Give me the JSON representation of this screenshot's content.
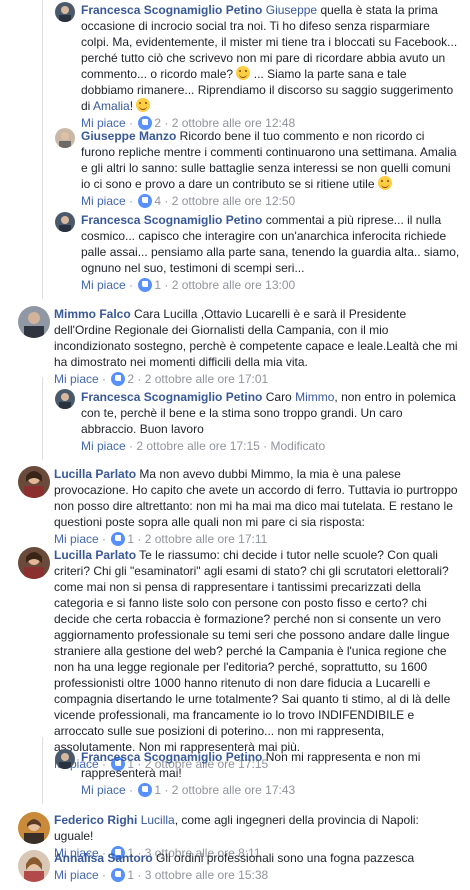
{
  "ui": {
    "like_label": "Mi piace",
    "dot": "·",
    "edited_label": "Modificato"
  },
  "comments": [
    {
      "author": "Francesca Scognamiglio Petino",
      "mention": "Giuseppe",
      "text1": " quella è stata la prima occasione di incrocio social tra noi. Ti ho difeso senza risparmiare colpi. Ma, evidentemente, il mister mi tiene tra i bloccati su Facebook... perché tutto ciò che scrivevo non mi pare di ricordare abbia avuto un commento... o ricordo male? ",
      "text2": " ... Siamo la parte sana e tale dobbiamo rimanere... Riprendiamo il discorso su saggio suggerimento di ",
      "mention2": "Amalia",
      "text3": "! ",
      "reactions": "2",
      "time": "2 ottobre alle ore 12:48"
    },
    {
      "author": "Giuseppe Manzo",
      "text": " Ricordo bene il tuo commento e non ricordo ci furono repliche mentre i commenti continuarono una settimana. Amalia e gli altri lo sanno: sulle battaglie senza interessi se non quelli comuni io ci sono e provo a dare un contributo se si ritiene utile ",
      "reactions": "4",
      "time": "2 ottobre alle ore 12:50"
    },
    {
      "author": "Francesca Scognamiglio Petino",
      "text": " commentai a più riprese... il nulla cosmico... capisco che interagire con un'anarchica inferocita richiede palle assai... pensiamo alla parte sana, tenendo la guardia alta.. siamo, ognuno nel suo, testimoni di scempi seri...",
      "reactions": "1",
      "time": "2 ottobre alle ore 13:00"
    },
    {
      "author": "Mimmo Falco",
      "text": " Cara Lucilla ,Ottavio Lucarelli è e sarà il Presidente dell'Ordine Regionale dei Giornalisti della Campania, con il mio incondizionato sostegno, perchè è competente capace e leale.Lealtà che mi ha dimostrato nei momenti difficili della mia vita.",
      "reactions": "2",
      "time": "2 ottobre alle ore 17:01"
    },
    {
      "author": "Francesca Scognamiglio Petino",
      "pre": " Caro ",
      "mention": "Mimmo",
      "text": ", non entro in polemica con te, perchè il bene e la stima sono troppo grandi. Un caro abbraccio. Buon lavoro",
      "time": "2 ottobre alle ore 17:15"
    },
    {
      "author": "Lucilla Parlato",
      "text": " Ma non avevo dubbi Mimmo, la mia è una palese provocazione. Ho capito che avete un accordo di ferro. Tuttavia io purtroppo non posso dire altrettanto: non mi ha mai ma dico mai tutelata. E restano le questioni poste sopra alle quali non mi pare ci sia risposta:",
      "reactions": "1",
      "time": "2 ottobre alle ore 17:11"
    },
    {
      "author": "Lucilla Parlato",
      "text": " Te le riassumo: chi decide i tutor nelle scuole? Con quali criteri? Chi gli \"esaminatori\" agli esami di stato? chi gli scrutatori elettorali? come mai non si pensa di rappresentare i tantissimi precarizzati della categoria e si fanno liste solo con persone con posto fisso e certo? chi decide che certa robaccia è formazione? perché non si consente un vero aggiornamento professionale su temi seri che possono andare dalle lingue straniere alla gestione del web? perché la Campania è l'unica regione che non ha una legge regionale per l'editoria? perché, soprattutto, su 1600 professionisti oltre 1000 hanno ritenuto di non dare fiducia a Lucarelli e compagnia disertando le urne totalmente? Sai quanto ti stimo, al di là delle vicende professionali, ma francamente io lo trovo INDIFENDIBILE e arroccato sulle sue posizioni di poterino... non mi rappresenta, assolutamente. Non mi rappresenterà mai più.",
      "reactions": "1",
      "time": "2 ottobre alle ore 17:15"
    },
    {
      "author": "Francesca Scognamiglio Petino",
      "text": " Non mi rappresenta e non mi rappresenterà mai!",
      "reactions": "1",
      "time": "2 ottobre alle ore 17:43"
    },
    {
      "author": "Federico Righi",
      "mention": "Lucilla",
      "text": ", come agli ingegneri della provincia di Napoli: uguale!",
      "reactions": "1",
      "time": "3 ottobre alle ore 8:11"
    },
    {
      "author": "Annalisa Santoro",
      "text": " Gli ordini professionali sono una fogna pazzesca",
      "reactions": "1",
      "time": "3 ottobre alle ore 15:38"
    }
  ],
  "colors": {
    "link": "#385898",
    "meta": "#90949c",
    "like": "#4267b2",
    "reaction": "#5890ff"
  }
}
